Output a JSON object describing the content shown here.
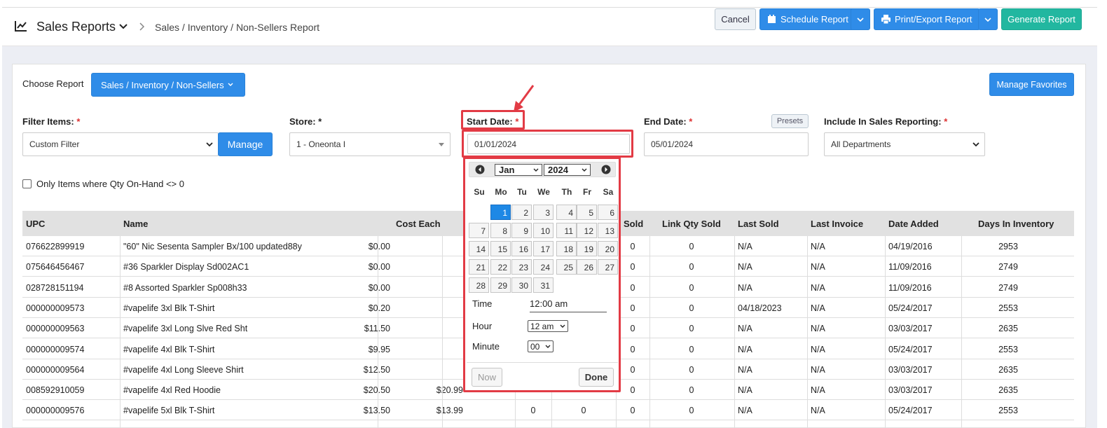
{
  "header": {
    "title": "Sales Reports",
    "breadcrumb": "Sales / Inventory / Non-Sellers Report",
    "cancel": "Cancel",
    "schedule": "Schedule Report",
    "print": "Print/Export Report",
    "generate": "Generate Report"
  },
  "report": {
    "choose_label": "Choose Report",
    "selected": "Sales / Inventory / Non-Sellers",
    "manage_favorites": "Manage Favorites"
  },
  "filters": {
    "filter_items_label": "Filter Items:",
    "filter_items_value": "Custom Filter",
    "manage": "Manage",
    "store_label": "Store: *",
    "store_value": "1 - Oneonta I",
    "start_label": "Start Date:",
    "start_value": "01/01/2024",
    "end_label": "End Date:",
    "end_value": "05/01/2024",
    "presets": "Presets",
    "include_label": "Include In Sales Reporting:",
    "include_value": "All Departments",
    "required_mark": "*",
    "checkbox_label": "Only Items where Qty On-Hand <> 0"
  },
  "table": {
    "headers": [
      "UPC",
      "Name",
      "Cost Each",
      "Sold",
      "Link Qty Sold",
      "Last Sold",
      "Last Invoice",
      "Date Added",
      "Days In Inventory"
    ],
    "rows": [
      {
        "upc": "076622899919",
        "name": "\"60\" Nic Sesenta Sampler Bx/100 updated88y",
        "cost": "$0.00",
        "price": "",
        "c4": "",
        "c5": "",
        "sold": "0",
        "link": "0",
        "last_sold": "N/A",
        "last_invoice": "N/A",
        "added": "04/19/2016",
        "days": "2953"
      },
      {
        "upc": "075646456467",
        "name": "#36 Sparkler Display Sd002AC1",
        "cost": "$0.00",
        "price": "",
        "c4": "",
        "c5": "",
        "sold": "0",
        "link": "0",
        "last_sold": "N/A",
        "last_invoice": "N/A",
        "added": "11/09/2016",
        "days": "2749"
      },
      {
        "upc": "028728151194",
        "name": "#8 Assorted Sparkler Sp008h33",
        "cost": "$0.00",
        "price": "",
        "c4": "",
        "c5": "",
        "sold": "0",
        "link": "0",
        "last_sold": "N/A",
        "last_invoice": "N/A",
        "added": "11/09/2016",
        "days": "2749"
      },
      {
        "upc": "000000009573",
        "name": "#vapelife 3xl Blk T-Shirt",
        "cost": "$0.20",
        "price": "",
        "c4": "",
        "c5": "",
        "sold": "0",
        "link": "0",
        "last_sold": "04/18/2023",
        "last_invoice": "N/A",
        "added": "05/24/2017",
        "days": "2553"
      },
      {
        "upc": "000000009563",
        "name": "#vapelife 3xl Long Slve Red Sht",
        "cost": "$11.50",
        "price": "",
        "c4": "",
        "c5": "",
        "sold": "0",
        "link": "0",
        "last_sold": "N/A",
        "last_invoice": "N/A",
        "added": "03/03/2017",
        "days": "2635"
      },
      {
        "upc": "000000009574",
        "name": "#vapelife 4xl Blk T-Shirt",
        "cost": "$9.95",
        "price": "",
        "c4": "",
        "c5": "",
        "sold": "0",
        "link": "0",
        "last_sold": "N/A",
        "last_invoice": "N/A",
        "added": "05/24/2017",
        "days": "2553"
      },
      {
        "upc": "000000009564",
        "name": "#vapelife 4xl Long Sleeve Shirt",
        "cost": "$12.50",
        "price": "",
        "c4": "",
        "c5": "",
        "sold": "0",
        "link": "0",
        "last_sold": "N/A",
        "last_invoice": "N/A",
        "added": "03/03/2017",
        "days": "2635"
      },
      {
        "upc": "008592910059",
        "name": "#vapelife 4xl Red Hoodie",
        "cost": "$20.50",
        "price": "$20.99",
        "c4": "",
        "c5": "",
        "sold": "0",
        "link": "0",
        "last_sold": "N/A",
        "last_invoice": "N/A",
        "added": "03/03/2017",
        "days": "2635"
      },
      {
        "upc": "000000009576",
        "name": "#vapelife 5xl Blk T-Shirt",
        "cost": "$13.50",
        "price": "$13.99",
        "c4": "0",
        "c5": "0",
        "sold": "0",
        "link": "0",
        "last_sold": "N/A",
        "last_invoice": "N/A",
        "added": "05/24/2017",
        "days": "2553"
      }
    ]
  },
  "datepicker": {
    "month": "Jan",
    "year": "2024",
    "dow": [
      "Su",
      "Mo",
      "Tu",
      "We",
      "Th",
      "Fr",
      "Sa"
    ],
    "days": [
      "1",
      "2",
      "3",
      "4",
      "5",
      "6",
      "7",
      "8",
      "9",
      "10",
      "11",
      "12",
      "13",
      "14",
      "15",
      "16",
      "17",
      "18",
      "19",
      "20",
      "21",
      "22",
      "23",
      "24",
      "25",
      "26",
      "27",
      "28",
      "29",
      "30",
      "31"
    ],
    "selected_day": "1",
    "time_label": "Time",
    "time_value": "12:00 am",
    "hour_label": "Hour",
    "hour_value": "12 am",
    "minute_label": "Minute",
    "minute_value": "00",
    "now": "Now",
    "done": "Done"
  },
  "colors": {
    "primary": "#2f8ce8",
    "teal": "#22b7a0",
    "highlight": "#e23b45"
  }
}
